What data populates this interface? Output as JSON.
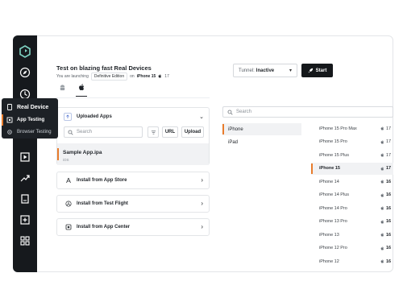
{
  "header": {
    "title": "Test on blazing fast Real Devices",
    "sub_prefix": "You are launching",
    "edition": "Definitive Edition",
    "sub_on": "on",
    "device": "iPhone 15",
    "os_version": "17"
  },
  "flyout": {
    "title": "Real Device",
    "app_testing": "App Testing",
    "browser_testing": "Browser Testing"
  },
  "tunnel": {
    "label": "Tunnel:",
    "value": "Inactive"
  },
  "start_label": "Start",
  "apps": {
    "heading": "Uploaded Apps",
    "search_placeholder": "Search",
    "url_label": "URL",
    "upload_label": "Upload",
    "selected_app": {
      "name": "Sample App.ipa",
      "os": "iOS"
    }
  },
  "install_options": [
    {
      "label": "Install from App Store"
    },
    {
      "label": "Install from Test Flight"
    },
    {
      "label": "Install from App Center"
    }
  ],
  "device_search_placeholder": "Search",
  "brands": [
    {
      "name": "iPhone",
      "selected": true
    },
    {
      "name": "iPad",
      "selected": false
    }
  ],
  "devices": [
    {
      "name": "iPhone 15 Pro Max",
      "version": "17"
    },
    {
      "name": "iPhone 15 Pro",
      "version": "17"
    },
    {
      "name": "iPhone 15 Plus",
      "version": "17"
    },
    {
      "name": "iPhone 15",
      "version": "17",
      "selected": true
    },
    {
      "name": "iPhone 14",
      "version": "16"
    },
    {
      "name": "iPhone 14 Plus",
      "version": "16"
    },
    {
      "name": "iPhone 14 Pro",
      "version": "16"
    },
    {
      "name": "iPhone 13 Pro",
      "version": "16"
    },
    {
      "name": "iPhone 13",
      "version": "16"
    },
    {
      "name": "iPhone 12 Pro",
      "version": "16"
    },
    {
      "name": "iPhone 12",
      "version": "16"
    }
  ],
  "colors": {
    "accent": "#e87c2c",
    "sidebar": "#16191d"
  }
}
